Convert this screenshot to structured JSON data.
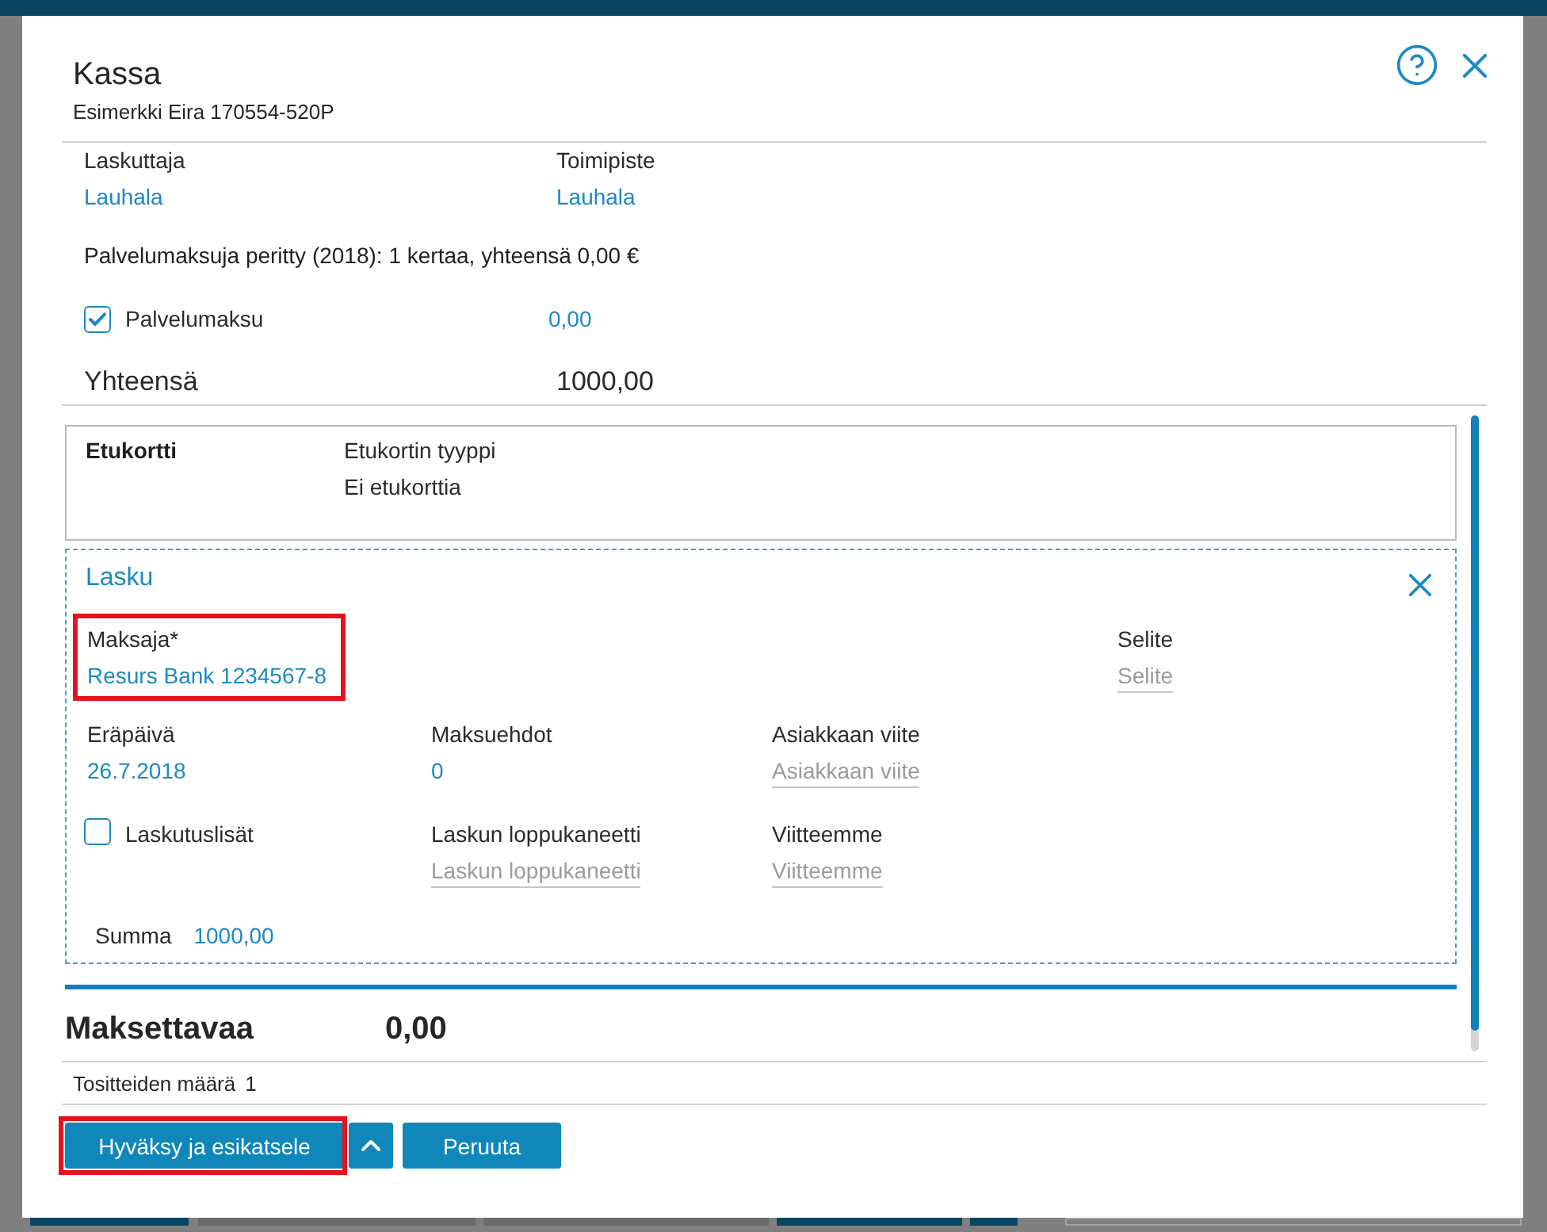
{
  "dialog": {
    "title": "Kassa",
    "subtitle": "Esimerkki Eira 170554-520P"
  },
  "details": [
    {
      "label": "Laskuttaja",
      "value": "Lauhala"
    },
    {
      "label": "Toimipiste",
      "value": "Lauhala"
    }
  ],
  "service_fee_note": "Palvelumaksuja peritty (2018): 1 kertaa, yhteensä 0,00 €",
  "service_fee": {
    "label": "Palvelumaksu",
    "checked": true,
    "value": "0,00"
  },
  "total": {
    "label": "Yhteensä",
    "value": "1000,00"
  },
  "benefit_card": {
    "title": "Etukortti",
    "label": "Etukortin tyyppi",
    "value": "Ei etukorttia"
  },
  "invoice": {
    "title": "Lasku",
    "payer": {
      "label": "Maksaja*",
      "value": "Resurs Bank 1234567-8",
      "highlighted": true
    },
    "description": {
      "label": "Selite",
      "placeholder": "Selite"
    },
    "rows": [
      [
        {
          "kind": "value",
          "label": "Eräpäivä",
          "value": "26.7.2018"
        },
        {
          "kind": "value",
          "label": "Maksuehdot",
          "value": "0"
        },
        {
          "kind": "input",
          "label": "Asiakkaan viite",
          "placeholder": "Asiakkaan viite"
        }
      ],
      [
        {
          "kind": "checkbox",
          "label": "Laskutuslisät",
          "checked": false
        },
        {
          "kind": "input",
          "label": "Laskun loppukaneetti",
          "placeholder": "Laskun loppukaneetti"
        },
        {
          "kind": "input",
          "label": "Viitteemme",
          "placeholder": "Viitteemme"
        }
      ]
    ],
    "sum": {
      "label": "Summa",
      "value": "1000,00"
    }
  },
  "amount_due": {
    "label": "Maksettavaa",
    "value": "0,00"
  },
  "voucher_count": {
    "label": "Tositteiden määrä",
    "value": "1"
  },
  "buttons": [
    {
      "kind": "primary",
      "label": "Hyväksy ja esikatsele",
      "highlighted": true
    },
    {
      "kind": "menu",
      "highlighted": false
    },
    {
      "kind": "primary",
      "label": "Peruuta",
      "highlighted": false
    }
  ]
}
